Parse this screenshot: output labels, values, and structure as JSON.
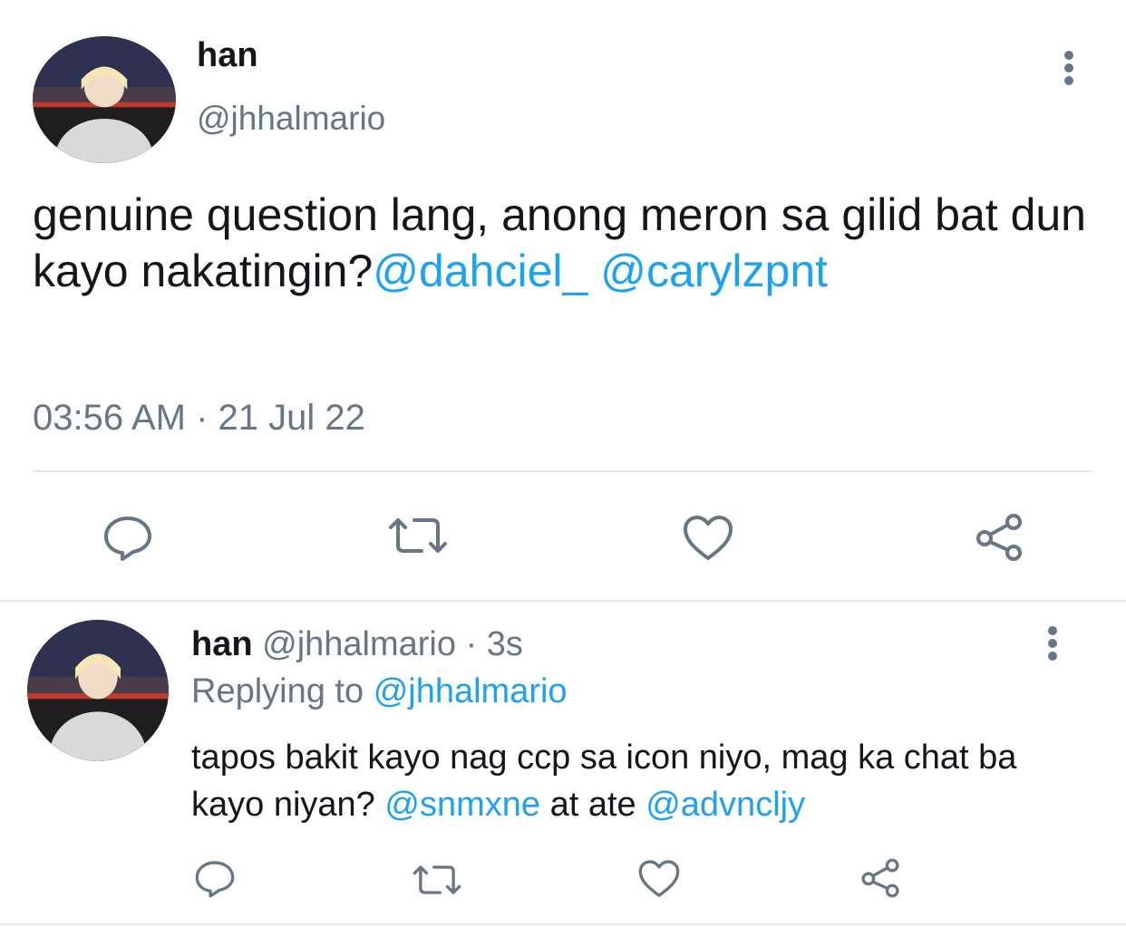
{
  "main_tweet": {
    "author_name": "han",
    "author_handle": "@jhhalmario",
    "text_plain": "genuine question lang, anong meron sa gilid bat dun kayo nakatingin?",
    "mention_1": "@dahciel_",
    "mention_2": "@carylzpnt",
    "timestamp": "03:56 AM · 21 Jul 22",
    "actions": [
      "reply-icon",
      "retweet-icon",
      "like-icon",
      "share-icon"
    ],
    "menu_icon": "more-vertical-icon"
  },
  "reply_tweet": {
    "author_name": "han",
    "author_handle": "@jhhalmario",
    "time_ago": "· 3s",
    "replying_label": "Replying to",
    "replying_handle": "@jhhalmario",
    "text_part1": "tapos bakit kayo nag ccp sa icon niyo, mag ka chat ba kayo niyan?",
    "mention_1": "@snmxne",
    "text_part2": "at ate",
    "mention_2": "@advncljy",
    "actions": [
      "reply-icon",
      "retweet-icon",
      "like-icon",
      "share-icon"
    ],
    "menu_icon": "more-vertical-icon"
  },
  "colors": {
    "link": "#1da1f2",
    "secondary_text": "#657786",
    "icon": "#657786",
    "divider": "#e1e8ed"
  }
}
